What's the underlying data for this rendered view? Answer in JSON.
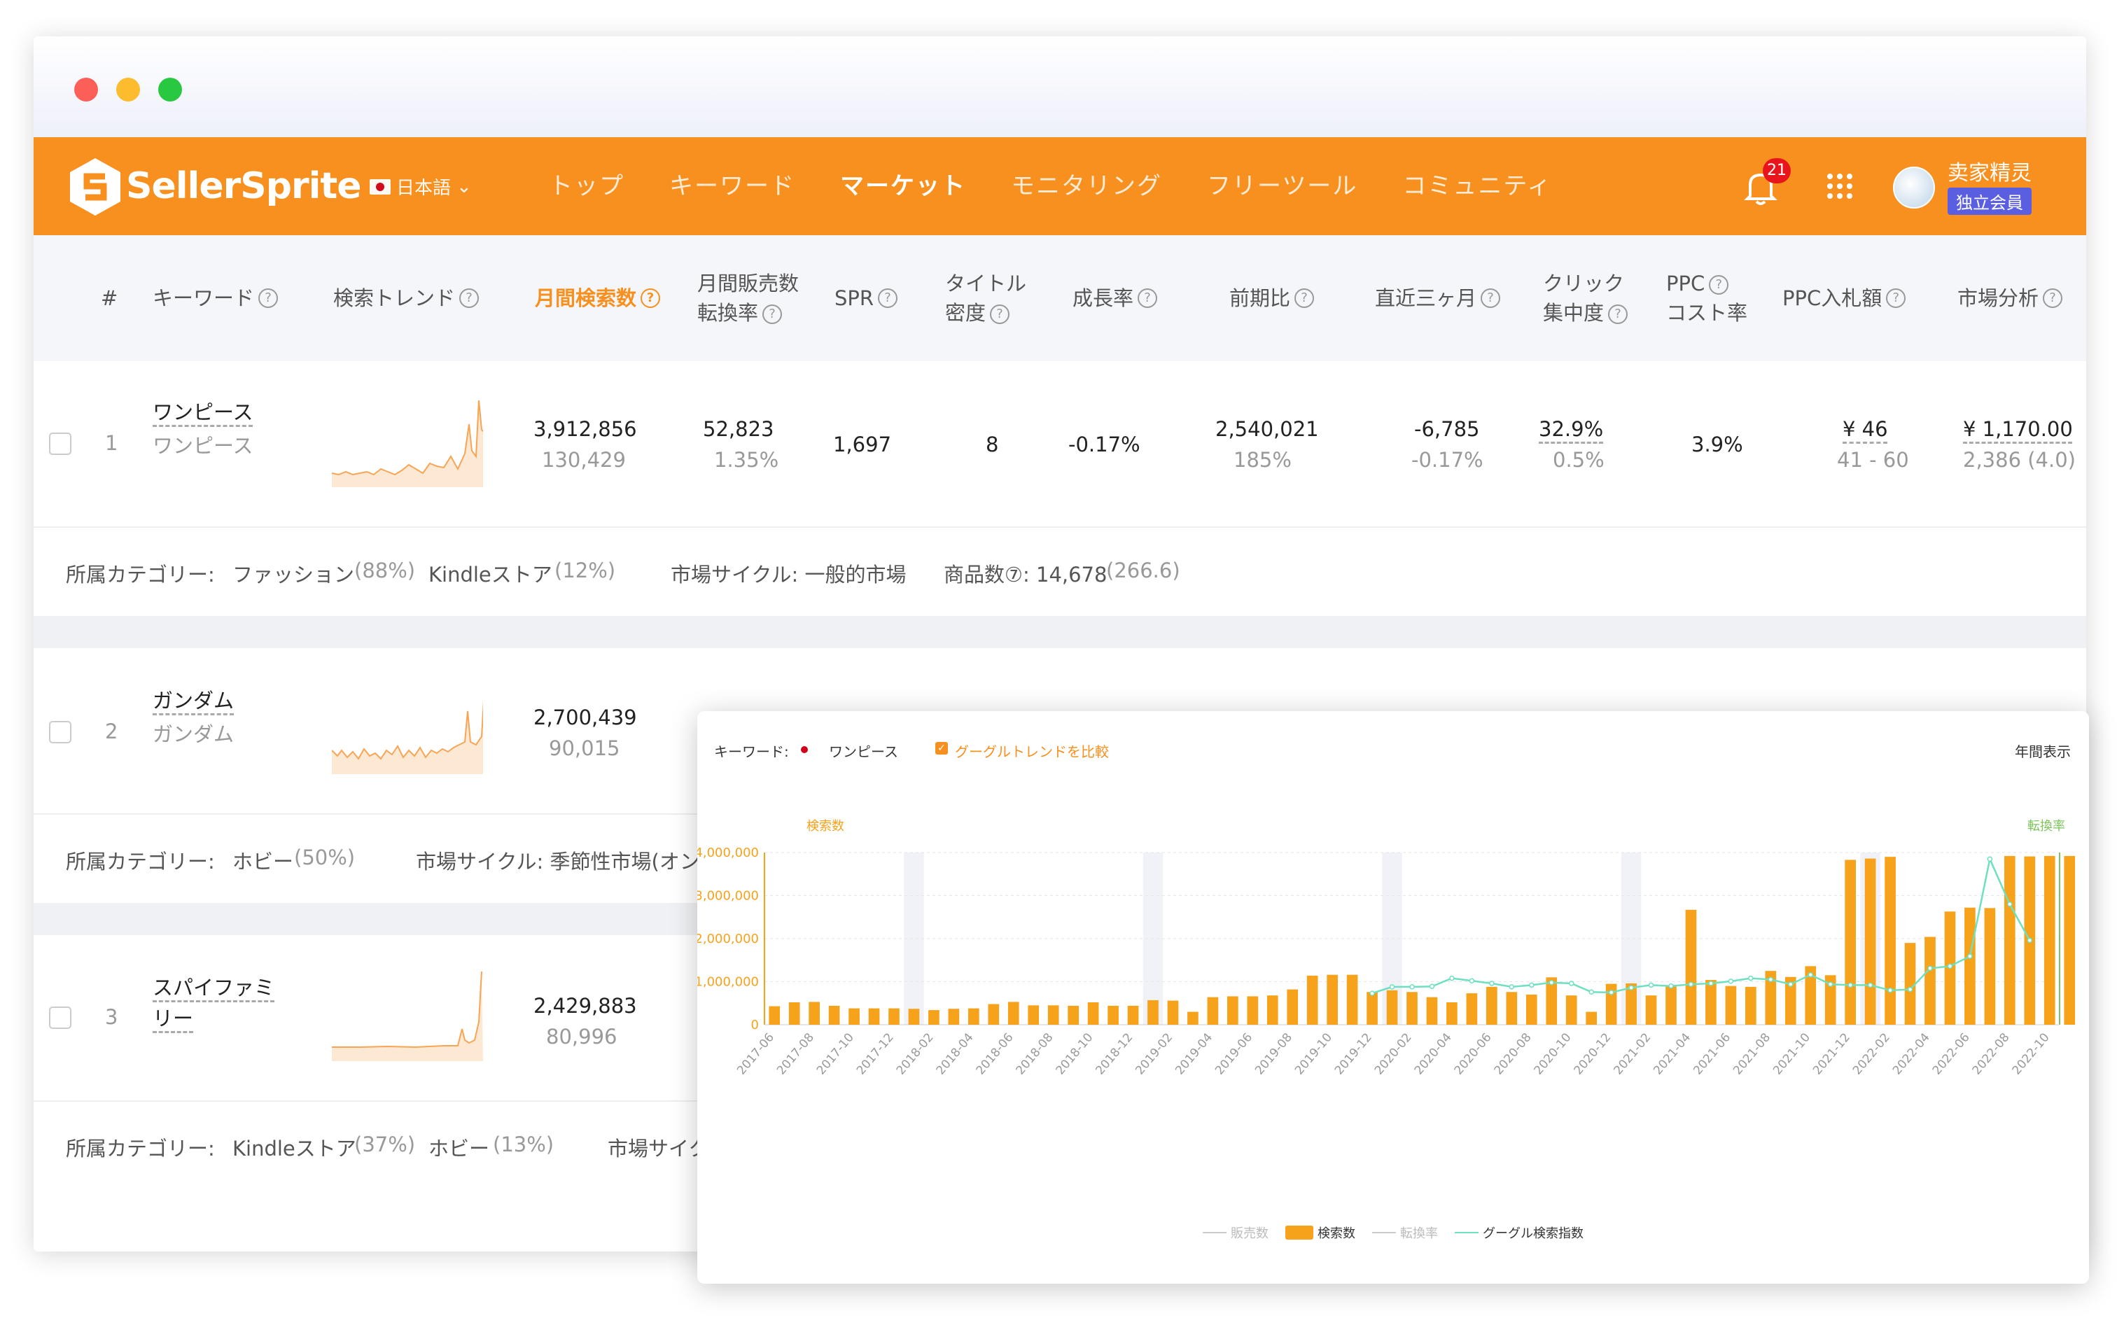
{
  "nav": {
    "brand": "SellerSprite",
    "language": "日本語",
    "menu": [
      "トップ",
      "キーワード",
      "マーケット",
      "モニタリング",
      "フリーツール",
      "コミュニティ"
    ],
    "active_menu": "マーケット",
    "notification_count": "21",
    "user_name": "卖家精灵",
    "member_badge": "独立会員"
  },
  "table": {
    "headers": {
      "num": "#",
      "keyword": "キーワード",
      "trend": "検索トレンド",
      "monthly_search": "月間検索数",
      "monthly_sales_l1": "月間販売数",
      "monthly_sales_l2": "転換率",
      "spr": "SPR",
      "title_l1": "タイトル",
      "title_l2": "密度",
      "growth": "成長率",
      "prev": "前期比",
      "recent": "直近三ヶ月",
      "click_l1": "クリック",
      "click_l2": "集中度",
      "ppc_l1": "PPC",
      "ppc_l2": "コスト率",
      "bid": "PPC入札額",
      "market": "市場分析"
    },
    "rows": [
      {
        "num": "1",
        "keyword": "ワンピース",
        "keyword_sub": "ワンピース",
        "search": "3,912,856",
        "search_sub": "130,429",
        "sales": "52,823",
        "sales_sub": "1.35%",
        "spr": "1,697",
        "title": "8",
        "growth": "-0.17%",
        "prev": "2,540,021",
        "prev_sub": "185%",
        "recent": "-6,785",
        "recent_sub": "-0.17%",
        "click": "32.9%",
        "click_sub": "0.5%",
        "ppc": "3.9%",
        "bid": "¥  46",
        "bid_sub": "41 - 60",
        "market": "¥  1,170.00",
        "market_sub": "2,386 (4.0)",
        "cat_label": "所属カテゴリー:",
        "cat1": "ファッション",
        "cat1_pct": "(88%)",
        "cat2": "Kindleストア",
        "cat2_pct": "(12%)",
        "cycle": "市場サイクル: 一般的市場",
        "products_label": "商品数⑦: 14,678",
        "products_sub": "(266.6)"
      },
      {
        "num": "2",
        "keyword": "ガンダム",
        "keyword_sub": "ガンダム",
        "search": "2,700,439",
        "search_sub": "90,015",
        "cat_label": "所属カテゴリー:",
        "cat1": "ホビー",
        "cat1_pct": "(50%)",
        "cycle": "市場サイクル: 季節性市場(オン"
      },
      {
        "num": "3",
        "keyword": "スパイファミ",
        "keyword2": "リー",
        "search": "2,429,883",
        "search_sub": "80,996",
        "cat_label": "所属カテゴリー:",
        "cat1": "Kindleストア",
        "cat1_pct": "(37%)",
        "cat2": "ホビー",
        "cat2_pct": "(13%)",
        "cycle": "市場サイク"
      }
    ]
  },
  "popup": {
    "keyword_label": "キーワード:",
    "keyword": "ワンピース",
    "compare_label": "グーグルトレンドを比較",
    "view_label": "年間表示",
    "left_axis_title": "検索数",
    "right_axis_title": "転換率",
    "legend": [
      "販売数",
      "検索数",
      "転換率",
      "グーグル検索指数"
    ]
  },
  "chart_data": {
    "type": "bar",
    "title": "",
    "ylim": [
      0,
      4000000
    ],
    "y_ticks": [
      "0",
      "1,000,000",
      "2,000,000",
      "3,000,000",
      "4,000,000"
    ],
    "x_tick_labels": [
      "2017-06",
      "2017-08",
      "2017-10",
      "2017-12",
      "2018-02",
      "2018-04",
      "2018-06",
      "2018-08",
      "2018-10",
      "2018-12",
      "2019-02",
      "2019-04",
      "2019-06",
      "2019-08",
      "2019-10",
      "2019-12",
      "2020-02",
      "2020-04",
      "2020-06",
      "2020-08",
      "2020-10",
      "2020-12",
      "2021-02",
      "2021-04",
      "2021-06",
      "2021-08",
      "2021-10",
      "2021-12",
      "2022-02",
      "2022-04",
      "2022-06",
      "2022-08",
      "2022-10"
    ],
    "categories": [
      "2017-06",
      "2017-07",
      "2017-08",
      "2017-09",
      "2017-10",
      "2017-11",
      "2017-12",
      "2018-01",
      "2018-02",
      "2018-03",
      "2018-04",
      "2018-05",
      "2018-06",
      "2018-07",
      "2018-08",
      "2018-09",
      "2018-10",
      "2018-11",
      "2018-12",
      "2019-01",
      "2019-02",
      "2019-03",
      "2019-04",
      "2019-05",
      "2019-06",
      "2019-07",
      "2019-08",
      "2019-09",
      "2019-10",
      "2019-11",
      "2019-12",
      "2020-01",
      "2020-02",
      "2020-03",
      "2020-04",
      "2020-05",
      "2020-06",
      "2020-07",
      "2020-08",
      "2020-09",
      "2020-10",
      "2020-11",
      "2020-12",
      "2021-01",
      "2021-02",
      "2021-03",
      "2021-04",
      "2021-05",
      "2021-06",
      "2021-07",
      "2021-08",
      "2021-09",
      "2021-10",
      "2021-11",
      "2021-12",
      "2022-01",
      "2022-02",
      "2022-03",
      "2022-04",
      "2022-05",
      "2022-06",
      "2022-07",
      "2022-08",
      "2022-09",
      "2022-10"
    ],
    "series": [
      {
        "name": "検索数",
        "color": "#f7a21b",
        "values": [
          430000,
          520000,
          530000,
          440000,
          380000,
          380000,
          380000,
          370000,
          340000,
          370000,
          380000,
          480000,
          530000,
          450000,
          450000,
          440000,
          520000,
          440000,
          440000,
          570000,
          560000,
          300000,
          640000,
          660000,
          660000,
          680000,
          820000,
          1140000,
          1160000,
          1160000,
          760000,
          800000,
          760000,
          640000,
          520000,
          730000,
          880000,
          760000,
          700000,
          1100000,
          680000,
          300000,
          950000,
          960000,
          680000,
          900000,
          2670000,
          1040000,
          900000,
          880000,
          1250000,
          1110000,
          1360000,
          1150000,
          3830000,
          3860000,
          3900000,
          1900000,
          2040000,
          2630000,
          2720000,
          2710000,
          3920000,
          3910000,
          3920000,
          3920000
        ]
      },
      {
        "name": "グーグル検索指数",
        "color": "#6ee0c0",
        "values": [
          null,
          null,
          null,
          null,
          null,
          null,
          null,
          null,
          null,
          null,
          null,
          null,
          null,
          null,
          null,
          null,
          null,
          null,
          null,
          null,
          null,
          null,
          null,
          null,
          null,
          null,
          null,
          null,
          null,
          null,
          730000,
          880000,
          880000,
          890000,
          1080000,
          1020000,
          960000,
          880000,
          920000,
          980000,
          960000,
          760000,
          750000,
          860000,
          920000,
          900000,
          940000,
          960000,
          1010000,
          1080000,
          1050000,
          940000,
          1160000,
          940000,
          920000,
          920000,
          800000,
          820000,
          1310000,
          1360000,
          1590000,
          3850000,
          2800000,
          1960000
        ]
      }
    ],
    "legend_position": "bottom"
  }
}
